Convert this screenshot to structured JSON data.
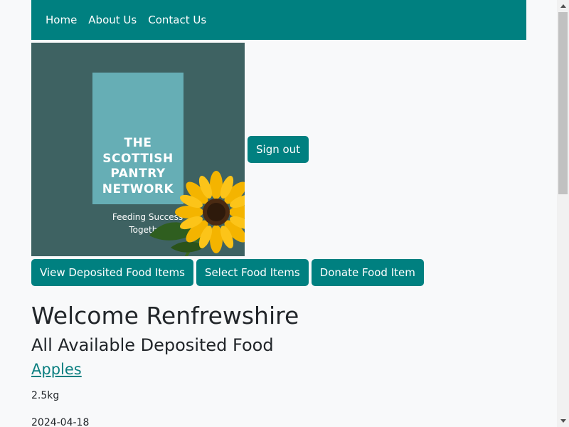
{
  "nav": {
    "items": [
      {
        "label": "Home"
      },
      {
        "label": "About Us"
      },
      {
        "label": "Contact Us"
      }
    ]
  },
  "logo": {
    "title": "THE\nSCOTTISH\nPANTRY\nNETWORK",
    "tagline": "Feeding Success\nTogether"
  },
  "header": {
    "signout_label": "Sign out"
  },
  "actions": {
    "view_label": "View Deposited Food Items",
    "select_label": "Select Food Items",
    "donate_label": "Donate Food Item"
  },
  "main": {
    "welcome": "Welcome Renfrewshire",
    "subtitle": "All Available Deposited Food",
    "food_items": [
      {
        "name": "Apples",
        "quantity": "2.5kg",
        "date": "2024-04-18"
      }
    ]
  },
  "colors": {
    "brand": "#008080",
    "background": "#f8f9fa",
    "logo_background": "#3e6262",
    "logo_panel": "#66aeb5"
  },
  "icons": {
    "scroll_up": "chevron-up-icon",
    "scroll_down": "chevron-down-icon",
    "logo_art": "sunflower-icon"
  }
}
